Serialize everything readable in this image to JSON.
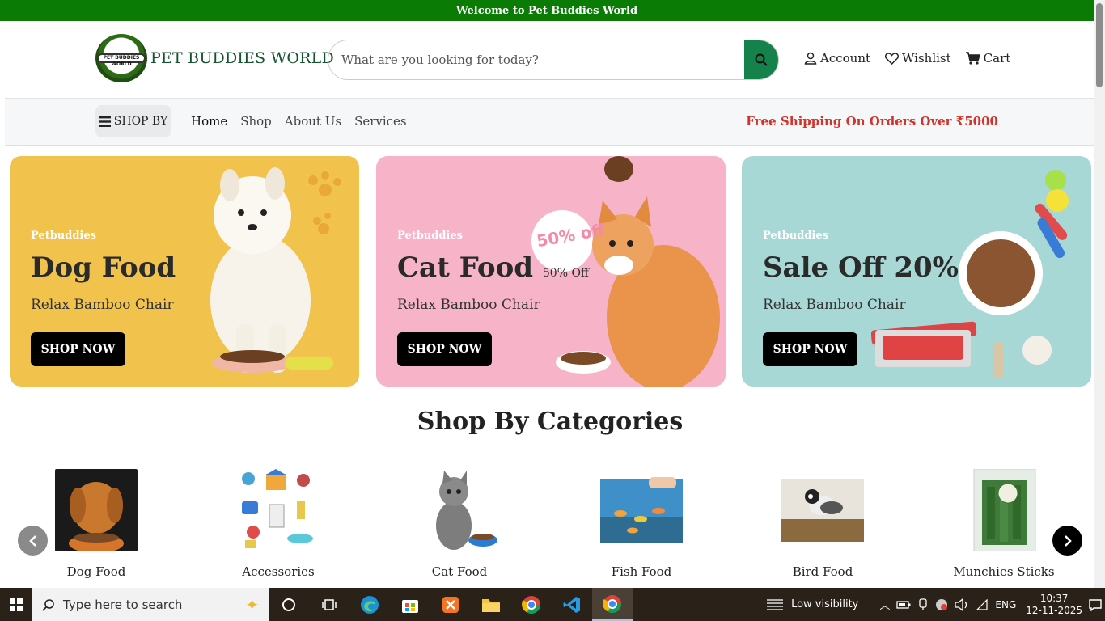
{
  "topbar": {
    "text": "Welcome to Pet Buddies World"
  },
  "header": {
    "logo_badge_text": "PET BUDDIES WORLD",
    "logo_text": "PET BUDDIES WORLD",
    "search_placeholder": "What are you looking for today?",
    "links": [
      {
        "label": "Account",
        "icon": "user-icon"
      },
      {
        "label": "Wishlist",
        "icon": "heart-icon"
      },
      {
        "label": "Cart",
        "icon": "cart-icon"
      }
    ]
  },
  "navbar": {
    "shop_by": "SHOP BY",
    "links": [
      "Home",
      "Shop",
      "About Us",
      "Services"
    ],
    "active": "Home",
    "free_shipping": "Free Shipping On Orders Over ₹5000"
  },
  "banners": [
    {
      "small": "Petbuddies",
      "title": "Dog Food",
      "title_sub": "",
      "desc": "Relax Bamboo Chair",
      "button": "SHOP NOW",
      "color": "#f1c24c"
    },
    {
      "small": "Petbuddies",
      "title": "Cat Food",
      "title_sub": "50% Off",
      "desc": "Relax Bamboo Chair",
      "button": "SHOP NOW",
      "badge": "50% off",
      "color": "#f7b3c8"
    },
    {
      "small": "Petbuddies",
      "title": "Sale Off 20%",
      "title_sub": "",
      "desc": "Relax Bamboo Chair",
      "button": "SHOP NOW",
      "color": "#a8d8d6"
    }
  ],
  "categories": {
    "title": "Shop By Categories",
    "items": [
      {
        "label": "Dog Food"
      },
      {
        "label": "Accessories"
      },
      {
        "label": "Cat Food"
      },
      {
        "label": "Fish Food"
      },
      {
        "label": "Bird Food"
      },
      {
        "label": "Munchies Sticks"
      }
    ]
  },
  "taskbar": {
    "search_placeholder": "Type here to search",
    "weather": "Low visibility",
    "language": "ENG",
    "time": "10:37",
    "date": "12-11-2025"
  },
  "colors": {
    "brand_green": "#0a7c06",
    "accent_red": "#d0342c",
    "search_button": "#14824a"
  }
}
